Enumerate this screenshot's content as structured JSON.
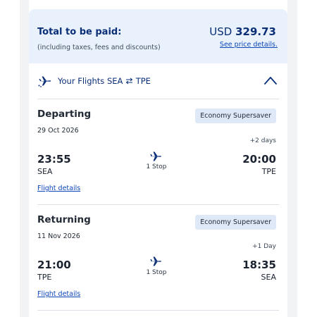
{
  "colors": {
    "brand_navy": "#0a2f78",
    "link_blue": "#0c45b8",
    "total_bg": "#e9f2fc",
    "badge_bg": "#dfe8f6",
    "page_stripe": "#f2f3f5"
  },
  "total": {
    "label": "Total to be paid:",
    "sublabel": "(including taxes, fees and discounts)",
    "currency": "USD",
    "amount": "329.73",
    "price_details_link": "See price details."
  },
  "flights_header": {
    "icon": "airplane-icon",
    "prefix": "Your Flights",
    "origin": "SEA",
    "swap_icon": "round-trip-arrows-icon",
    "destination": "TPE",
    "toggle_icon": "chevron-up-icon"
  },
  "legs": [
    {
      "title": "Departing",
      "date": "29 Oct 2026",
      "cabin": "Economy Supersaver",
      "day_offset": "+2 days",
      "depart_time": "23:55",
      "depart_code": "SEA",
      "stops": "1 Stop",
      "arrive_time": "20:00",
      "arrive_code": "TPE",
      "details_link": "Flight details"
    },
    {
      "title": "Returning",
      "date": "11 Nov 2026",
      "cabin": "Economy Supersaver",
      "day_offset": "+1 Day",
      "depart_time": "21:00",
      "depart_code": "TPE",
      "stops": "1 Stop",
      "arrive_time": "18:35",
      "arrive_code": "SEA",
      "details_link": "Flight details"
    }
  ]
}
